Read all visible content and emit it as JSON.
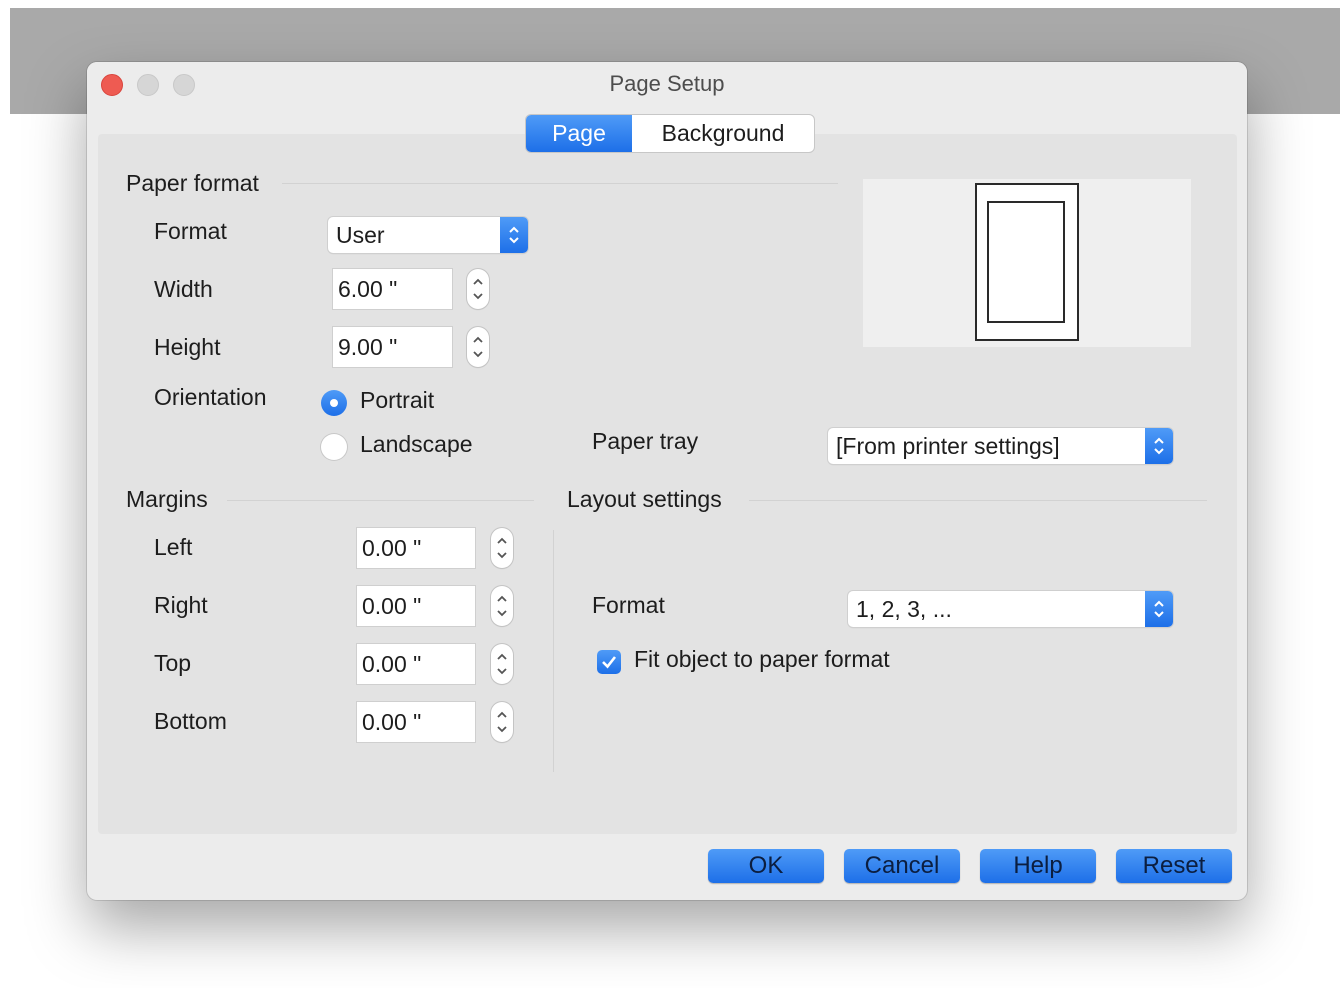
{
  "window": {
    "title": "Page Setup"
  },
  "tabs": [
    {
      "label": "Page",
      "active": true
    },
    {
      "label": "Background",
      "active": false
    }
  ],
  "paper_format": {
    "section_title": "Paper format",
    "format_label": "Format",
    "format_value": "User",
    "width_label": "Width",
    "width_value": "6.00 \"",
    "height_label": "Height",
    "height_value": "9.00 \"",
    "orientation_label": "Orientation",
    "orientation_options": [
      "Portrait",
      "Landscape"
    ],
    "orientation_selected": "Portrait"
  },
  "paper_tray": {
    "label": "Paper tray",
    "value": "[From printer settings]"
  },
  "margins": {
    "section_title": "Margins",
    "items": [
      {
        "label": "Left",
        "value": "0.00 \""
      },
      {
        "label": "Right",
        "value": "0.00 \""
      },
      {
        "label": "Top",
        "value": "0.00 \""
      },
      {
        "label": "Bottom",
        "value": "0.00 \""
      }
    ]
  },
  "layout_settings": {
    "section_title": "Layout settings",
    "format_label": "Format",
    "format_value": "1, 2, 3, ...",
    "fit_checkbox_label": "Fit object to paper format",
    "fit_checked": true
  },
  "buttons": {
    "ok": "OK",
    "cancel": "Cancel",
    "help": "Help",
    "reset": "Reset"
  },
  "colors": {
    "accent": "#2f84f0",
    "close": "#ee5b52",
    "panel": "#e3e3e3",
    "window": "#ececec"
  }
}
